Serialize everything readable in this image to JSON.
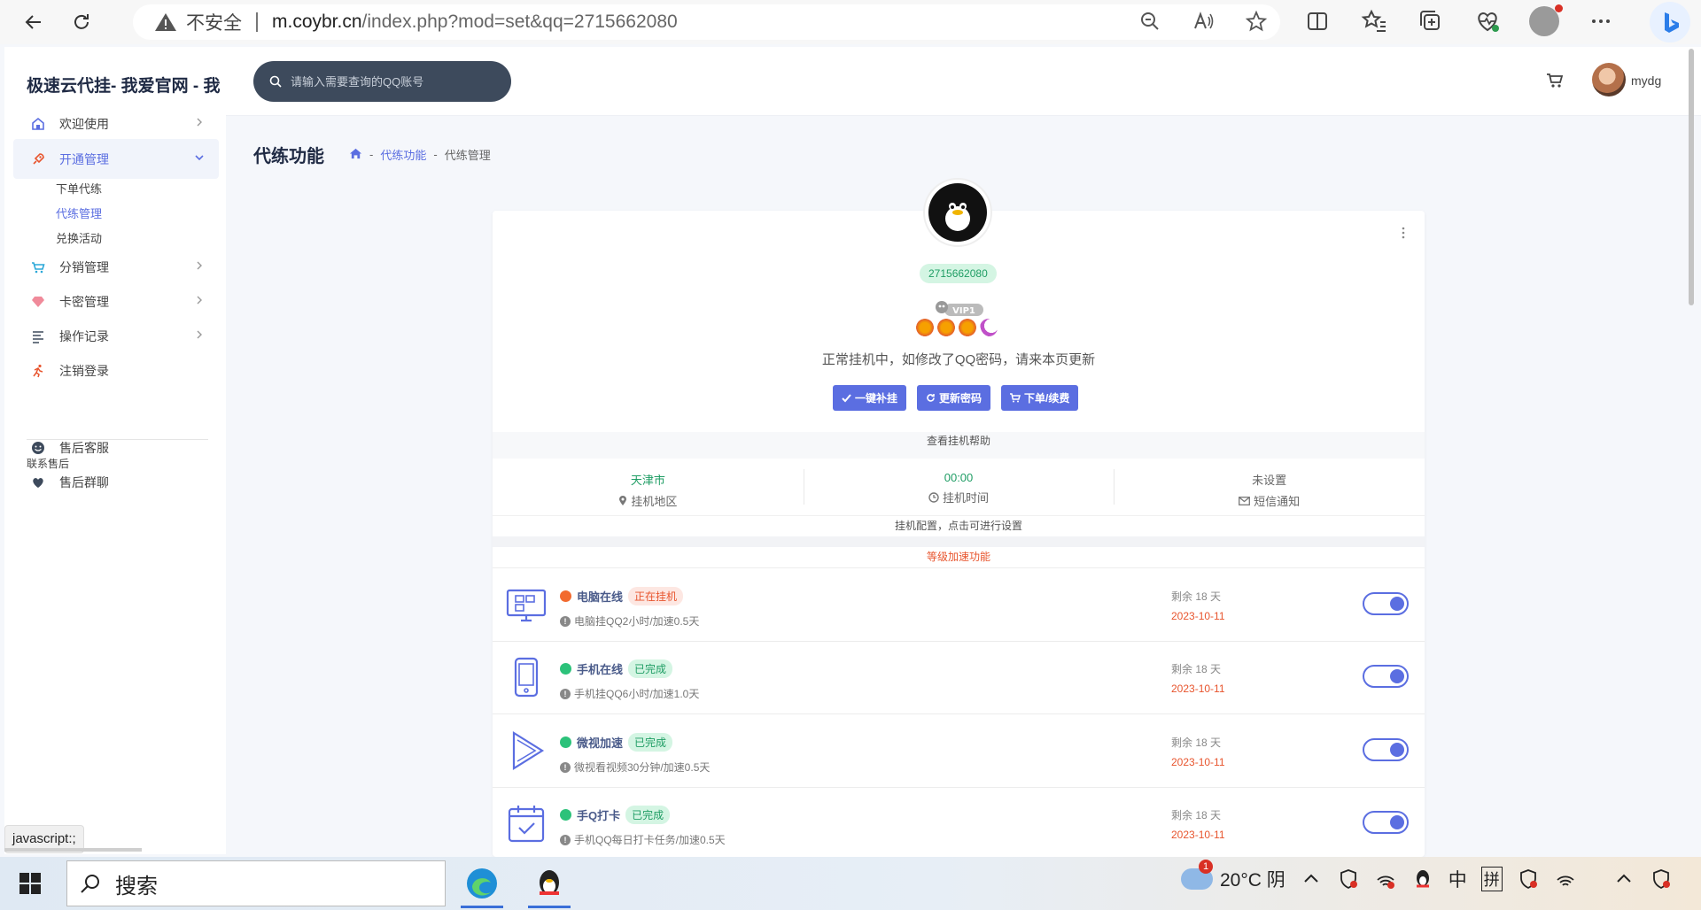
{
  "browser": {
    "insecure_label": "不安全",
    "url_host": "m.coybr.cn",
    "url_path": "/index.php?mod=set&qq=2715662080"
  },
  "sidebar": {
    "brand": "极速云代挂- 我爱官网 - 我",
    "items": [
      {
        "label": "欢迎使用",
        "icon": "home-icon"
      },
      {
        "label": "开通管理",
        "icon": "rocket-icon"
      },
      {
        "label": "分销管理",
        "icon": "cart-icon"
      },
      {
        "label": "卡密管理",
        "icon": "diamond-icon"
      },
      {
        "label": "操作记录",
        "icon": "list-icon"
      },
      {
        "label": "注销登录",
        "icon": "run-icon"
      }
    ],
    "sub_items": [
      "下单代练",
      "代练管理",
      "兑换活动"
    ],
    "section_title": "联系售后",
    "contact": [
      {
        "label": "售后客服",
        "icon": "smile-icon"
      },
      {
        "label": "售后群聊",
        "icon": "heart-icon"
      }
    ]
  },
  "header": {
    "search_placeholder": "请输入需要查询的QQ账号",
    "username": "mydg"
  },
  "page": {
    "title": "代练功能",
    "breadcrumb": [
      "代练功能",
      "代练管理"
    ]
  },
  "profile": {
    "qq": "2715662080",
    "status_msg": "正常挂机中，如修改了QQ密码，请来本页更新",
    "buttons": [
      "一键补挂",
      "更新密码",
      "下单/续费"
    ],
    "help": "查看挂机帮助",
    "stats": [
      {
        "value": "天津市",
        "label": "挂机地区"
      },
      {
        "value": "00:00",
        "label": "挂机时间"
      },
      {
        "value": "未设置",
        "label": "短信通知"
      }
    ],
    "config_hint": "挂机配置，点击可进行设置",
    "features_title": "等级加速功能"
  },
  "features": [
    {
      "name": "电脑在线",
      "tag": "正在挂机",
      "desc": "电脑挂QQ2小时/加速0.5天",
      "remain": "剩余 18 天",
      "date": "2023-10-11",
      "state": "running"
    },
    {
      "name": "手机在线",
      "tag": "已完成",
      "desc": "手机挂QQ6小时/加速1.0天",
      "remain": "剩余 18 天",
      "date": "2023-10-11",
      "state": "done"
    },
    {
      "name": "微视加速",
      "tag": "已完成",
      "desc": "微视看视频30分钟/加速0.5天",
      "remain": "剩余 18 天",
      "date": "2023-10-11",
      "state": "done"
    },
    {
      "name": "手Q打卡",
      "tag": "已完成",
      "desc": "手机QQ每日打卡任务/加速0.5天",
      "remain": "剩余 18 天",
      "date": "2023-10-11",
      "state": "done"
    }
  ],
  "statusbar": {
    "link": "javascript:;"
  },
  "taskbar": {
    "search_label": "搜索",
    "weather_badge": "1",
    "weather": "20°C 阴",
    "ime_1": "中",
    "ime_2": "拼"
  },
  "colors": {
    "accent": "#5b6ee1",
    "success": "#1f9d64",
    "danger": "#e8552e"
  }
}
